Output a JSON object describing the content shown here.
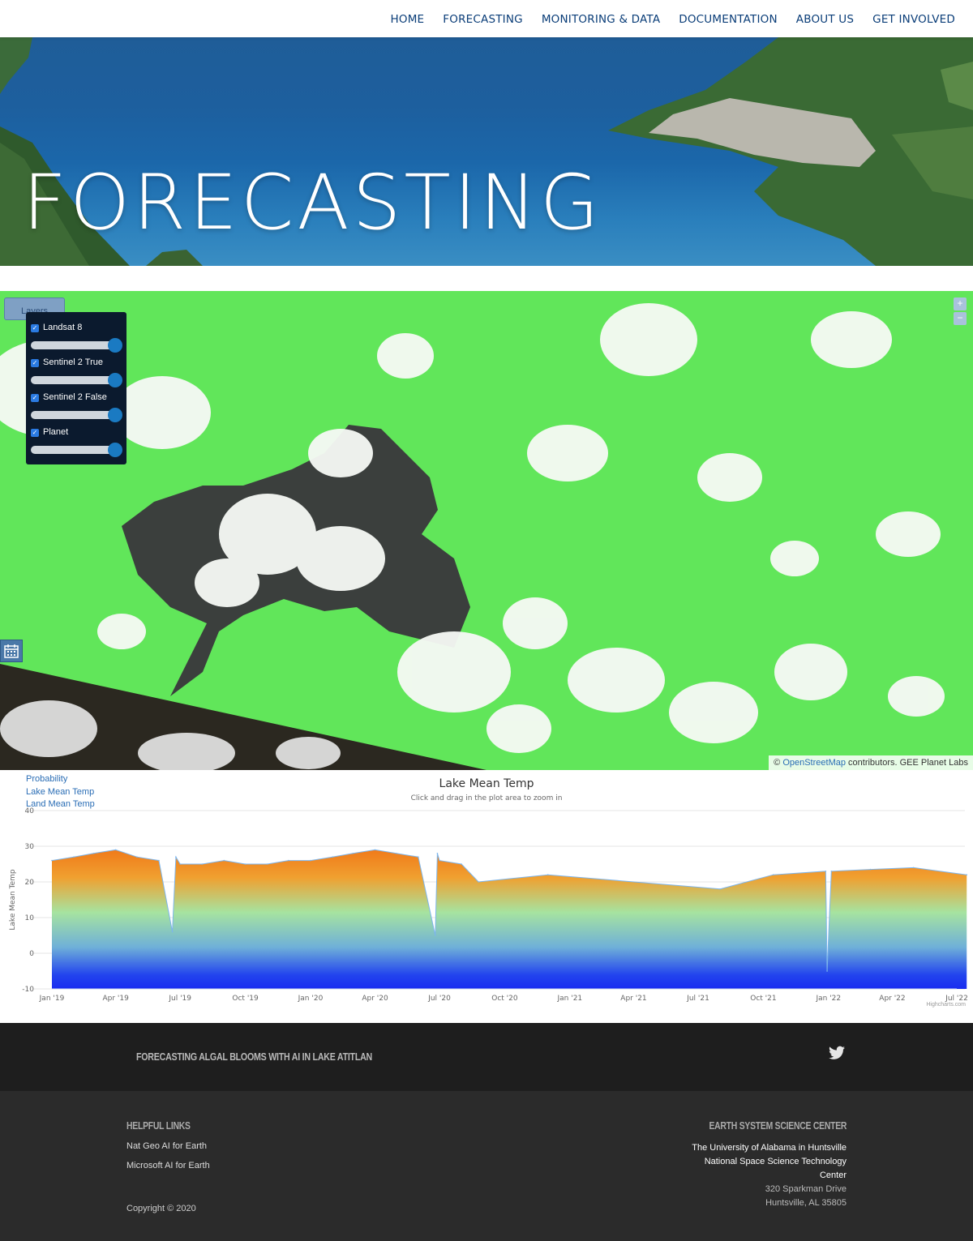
{
  "nav": {
    "items": [
      "HOME",
      "FORECASTING",
      "MONITORING & DATA",
      "DOCUMENTATION",
      "ABOUT US",
      "GET INVOLVED"
    ]
  },
  "hero": {
    "title": "FORECASTING"
  },
  "map": {
    "layers_button": "Layers",
    "layers": [
      {
        "label": "Landsat 8",
        "checked": true,
        "opacity": 1.0
      },
      {
        "label": "Sentinel 2 True",
        "checked": true,
        "opacity": 1.0
      },
      {
        "label": "Sentinel 2 False",
        "checked": true,
        "opacity": 1.0
      },
      {
        "label": "Planet",
        "checked": true,
        "opacity": 1.0
      }
    ],
    "zoom_in": "+",
    "zoom_out": "−",
    "attribution_prefix": "©",
    "attribution_link": "OpenStreetMap",
    "attribution_suffix": "contributors. GEE Planet Labs"
  },
  "chart_links": [
    "Probability",
    "Lake Mean Temp",
    "Land Mean Temp"
  ],
  "chart_data": {
    "type": "area",
    "title": "Lake Mean Temp",
    "subtitle": "Click and drag in the plot area to zoom in",
    "ylabel": "Lake Mean Temp",
    "xlabel": "",
    "ylim": [
      -10,
      40
    ],
    "y_ticks": [
      40,
      30,
      20,
      10,
      0,
      -10
    ],
    "x_ticks": [
      "Jan '19",
      "Apr '19",
      "Jul '19",
      "Oct '19",
      "Jan '20",
      "Apr '20",
      "Jul '20",
      "Oct '20",
      "Jan '21",
      "Apr '21",
      "Jul '21",
      "Oct '21",
      "Jan '22",
      "Apr '22",
      "Jul '22"
    ],
    "series": [
      {
        "name": "Lake Mean Temp",
        "x": [
          "2019-01-01",
          "2019-02-01",
          "2019-03-01",
          "2019-04-01",
          "2019-05-01",
          "2019-06-01",
          "2019-06-20",
          "2019-06-25",
          "2019-07-01",
          "2019-08-01",
          "2019-09-01",
          "2019-10-01",
          "2019-11-01",
          "2019-12-01",
          "2020-01-01",
          "2020-02-01",
          "2020-03-01",
          "2020-04-01",
          "2020-05-01",
          "2020-06-01",
          "2020-06-25",
          "2020-06-28",
          "2020-07-01",
          "2020-08-01",
          "2020-08-25",
          "2020-12-01",
          "2021-08-01",
          "2021-10-15",
          "2021-12-28",
          "2021-12-30",
          "2022-01-05",
          "2022-03-01",
          "2022-05-01",
          "2022-07-15"
        ],
        "y": [
          26,
          27,
          28,
          29,
          27,
          26,
          6,
          27,
          25,
          25,
          26,
          25,
          25,
          26,
          26,
          27,
          28,
          29,
          28,
          27,
          5,
          28,
          26,
          25,
          20,
          22,
          18,
          22,
          23,
          -5,
          23,
          23.5,
          24,
          22
        ]
      }
    ],
    "credits": "Highcharts.com"
  },
  "footer": {
    "tagline": "FORECASTING ALGAL BLOOMS WITH AI IN LAKE ATITLAN",
    "helpful_heading": "HELPFUL LINKS",
    "links": [
      "Nat Geo AI for Earth",
      "Microsoft AI for Earth"
    ],
    "copyright": "Copyright © 2020",
    "center_heading": "EARTH SYSTEM SCIENCE CENTER",
    "org_line1": "The University of Alabama in Huntsville",
    "org_line2": "National Space Science Technology",
    "org_line3": "Center",
    "address1": "320 Sparkman Drive",
    "address2": "Huntsville, AL 35805"
  }
}
